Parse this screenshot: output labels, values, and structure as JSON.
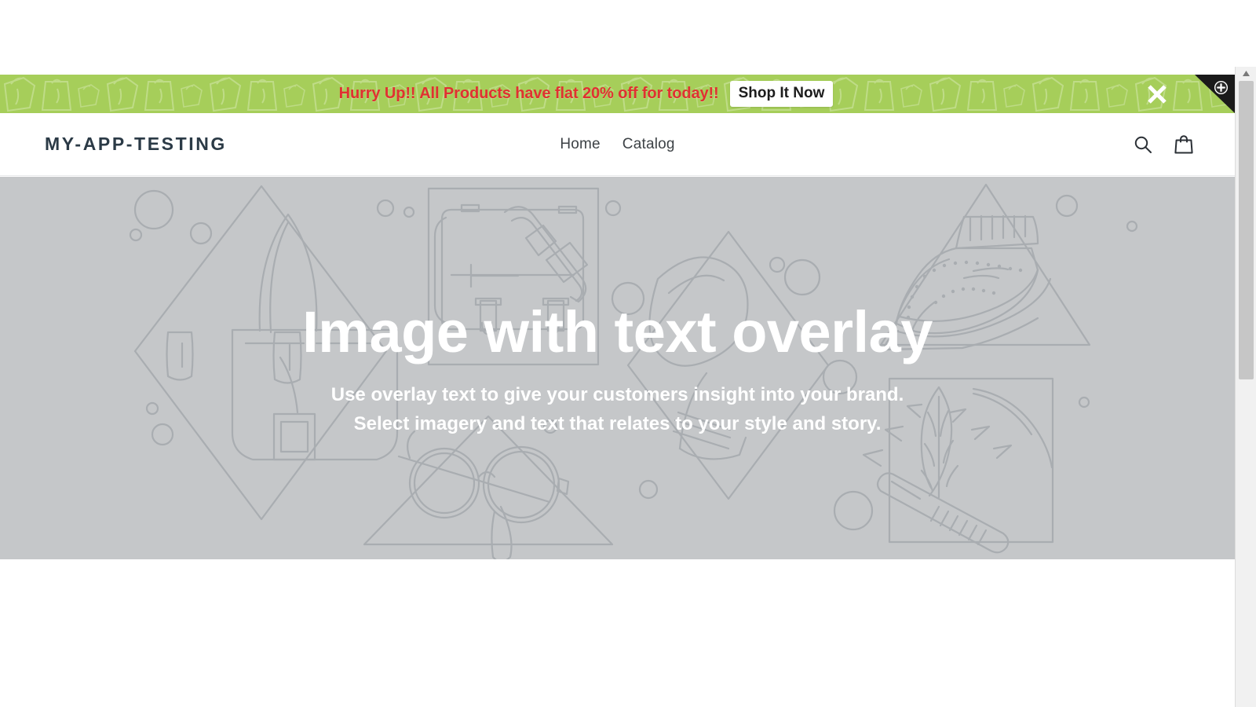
{
  "promo": {
    "text": "Hurry Up!! All Products have flat 20% off for today!!",
    "button_label": "Shop It Now",
    "background_color": "#a6ce5a",
    "text_color": "#e03131",
    "close_icon": "close-x-icon",
    "pattern_icon": "shopify-bag-pattern"
  },
  "corner_badge": {
    "icon": "plus-circle-icon",
    "color": "#1a1a1a"
  },
  "header": {
    "logo": "MY-APP-TESTING",
    "nav": [
      {
        "label": "Home"
      },
      {
        "label": "Catalog"
      }
    ],
    "search_icon": "search-icon",
    "cart_icon": "shopping-bag-icon"
  },
  "hero": {
    "title": "Image with text overlay",
    "subtitle_line1": "Use overlay text to give your customers insight into your brand.",
    "subtitle_line2": "Select imagery and text that relates to your style and story.",
    "background_color": "#c5c7c9",
    "text_color": "#ffffff",
    "artwork": "lifestyle-product-line-art-placeholder"
  },
  "scrollbar": {
    "up_arrow_icon": "chevron-up-icon"
  }
}
